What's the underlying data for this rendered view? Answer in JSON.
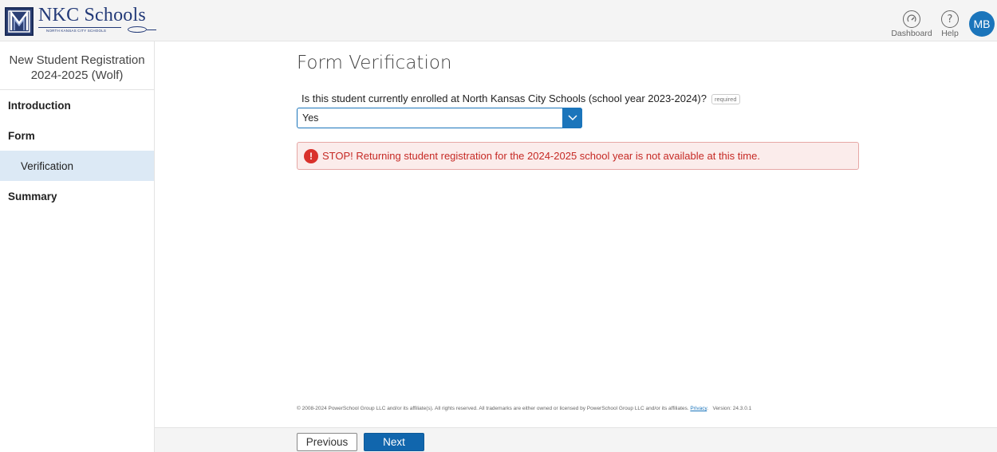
{
  "header": {
    "logo": {
      "name": "NKC Schools",
      "subtitle": "NORTH KANSAS CITY SCHOOLS"
    },
    "dashboard_label": "Dashboard",
    "dashboard_icon": "speedometer-icon",
    "help_label": "Help",
    "help_icon": "question-circle-icon",
    "avatar_initials": "MB",
    "avatar_color": "#1b75bb"
  },
  "sidebar": {
    "title_line1": "New Student Registration",
    "title_line2": "2024-2025 (Wolf)",
    "items": [
      {
        "label": "Introduction"
      },
      {
        "label": "Form"
      },
      {
        "label": "Verification",
        "active": true
      },
      {
        "label": "Summary"
      }
    ]
  },
  "main": {
    "title": "Form Verification",
    "question": "Is this student currently enrolled at North Kansas City Schools (school year 2023-2024)?",
    "required_label": "required",
    "select_value": "Yes",
    "alert_icon": "exclamation-circle-icon",
    "alert_text": "STOP! Returning student registration for the 2024-2025 school year is not available at this time.",
    "alert_color": "#c62a25"
  },
  "footer": {
    "copyright": "© 2008-2024 PowerSchool Group LLC and/or its affiliate(s). All rights reserved. All trademarks are either owned or licensed by PowerSchool Group LLC and/or its affiliates.",
    "privacy_label": "Privacy",
    "version": "Version: 24.3.0.1"
  },
  "nav": {
    "previous_label": "Previous",
    "next_label": "Next",
    "primary_color": "#1166ad"
  }
}
